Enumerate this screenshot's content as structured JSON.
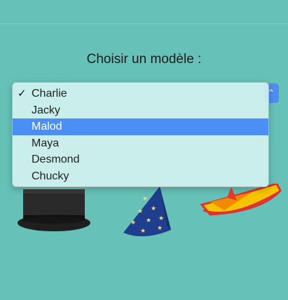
{
  "page": {
    "title": "Choisir un modèle :"
  },
  "select": {
    "selected_value": "Charlie",
    "highlighted_value": "Malod",
    "options": [
      "Charlie",
      "Jacky",
      "Malod",
      "Maya",
      "Desmond",
      "Chucky"
    ],
    "checkmark": "✓",
    "arrow_glyph": "⌃"
  },
  "colors": {
    "background": "#66c2b8",
    "menu_background": "#d3f2ef",
    "highlight": "#4b8ff5",
    "select_button": "#4e8ef2"
  },
  "images": [
    "top-hat",
    "wizard-hat",
    "paper-boat-hat"
  ]
}
